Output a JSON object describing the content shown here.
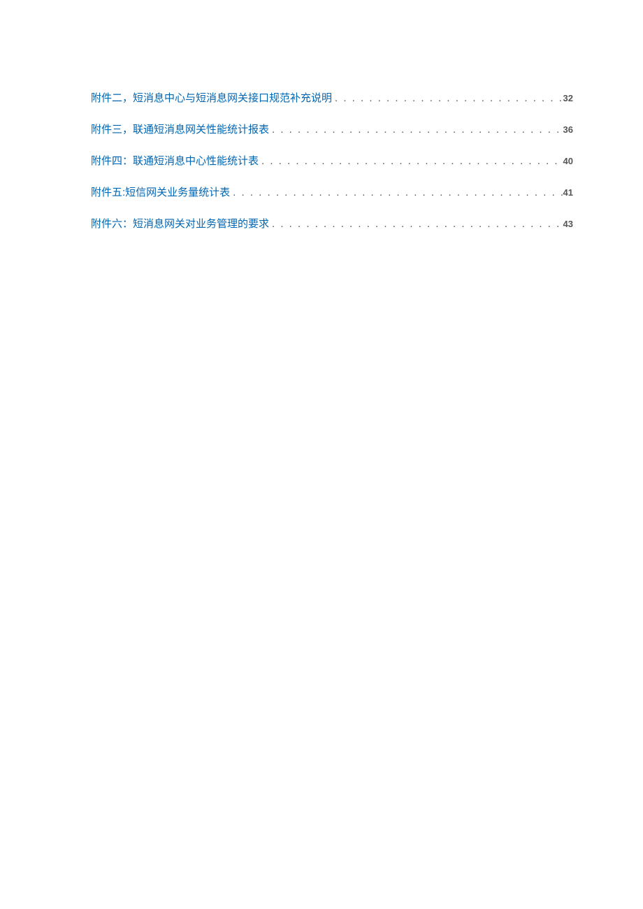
{
  "toc": [
    {
      "title": "附件二，短消息中心与短消息网关接口规范补充说明",
      "page": "32"
    },
    {
      "title": "附件三，联通短消息网关性能统计报表",
      "page": "36"
    },
    {
      "title": "附件四：联通短消息中心性能统计表",
      "page": "40"
    },
    {
      "title": "附件五:短信网关业务量统计表",
      "page": "41"
    },
    {
      "title": "附件六：短消息网关对业务管理的要求",
      "page": "43"
    }
  ],
  "leader": " . . . . . . . . . . . . . . . . . . . . . . . . . . . . . . . . . . . . . . . . . . . . . . . . . . . . . . . . . . . . . . . . . . . . . . . . . . . . . . . . . . . . . . . . . . "
}
